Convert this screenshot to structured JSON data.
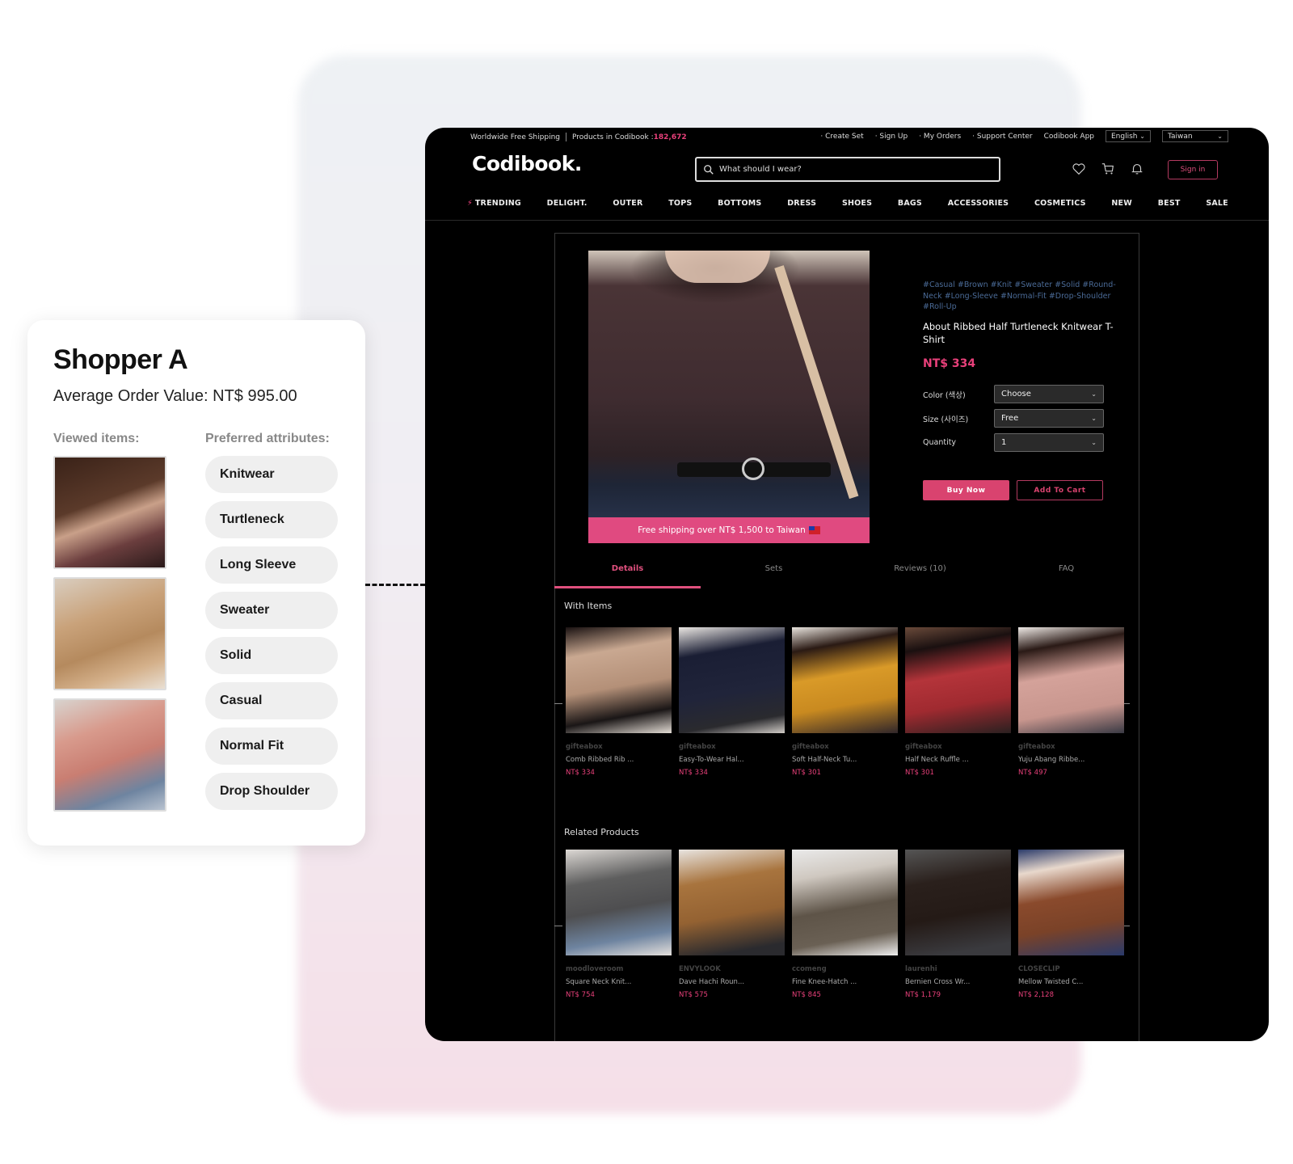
{
  "shopper": {
    "title": "Shopper A",
    "aov": "Average Order Value: NT$ 995.00",
    "viewed_label": "Viewed items:",
    "attrs_label": "Preferred attributes:",
    "viewed": [
      "brown-knit-sweater-image",
      "beige-knit-sweater-image",
      "pink-knit-sweater-image"
    ],
    "attributes": [
      "Knitwear",
      "Turtleneck",
      "Long Sleeve",
      "Sweater",
      "Solid",
      "Casual",
      "Normal Fit",
      "Drop Shoulder"
    ]
  },
  "store": {
    "topbar": {
      "shipping": "Worldwide Free Shipping",
      "products_label": "Products in Codibook : ",
      "products_count": "182,672",
      "links": [
        "· Create Set",
        "· Sign Up",
        "· My Orders",
        "· Support Center",
        "Codibook App"
      ],
      "language": "English",
      "country": "Taiwan"
    },
    "logo": "Codibook.",
    "search_placeholder": "What should I wear?",
    "signin": "Sign in",
    "nav": [
      "TRENDING",
      "DELIGHT.",
      "OUTER",
      "TOPS",
      "BOTTOMS",
      "DRESS",
      "SHOES",
      "BAGS",
      "ACCESSORIES",
      "COSMETICS",
      "NEW",
      "BEST",
      "SALE"
    ],
    "product": {
      "banner": "Free shipping over NT$ 1,500 to Taiwan",
      "tags": "#Casual #Brown #Knit #Sweater #Solid #Round-Neck #Long-Sleeve #Normal-Fit #Drop-Shoulder #Roll-Up",
      "title": "About Ribbed Half Turtleneck Knitwear T-Shirt",
      "price": "NT$ 334",
      "options": [
        {
          "label": "Color (색상)",
          "value": "Choose"
        },
        {
          "label": "Size (사이즈)",
          "value": "Free"
        },
        {
          "label": "Quantity",
          "value": "1"
        }
      ],
      "buy_now": "Buy Now",
      "add_to_cart": "Add To Cart"
    },
    "tabs": [
      "Details",
      "Sets",
      "Reviews (10)",
      "FAQ"
    ],
    "active_tab": "Details",
    "with_items": {
      "title": "With Items",
      "items": [
        {
          "brand": "gifteabox",
          "name": "Comb Ribbed Rib ...",
          "price": "NT$ 334"
        },
        {
          "brand": "gifteabox",
          "name": "Easy-To-Wear Hal...",
          "price": "NT$ 334"
        },
        {
          "brand": "gifteabox",
          "name": "Soft Half-Neck Tu...",
          "price": "NT$ 301"
        },
        {
          "brand": "gifteabox",
          "name": "Half Neck Ruffle ...",
          "price": "NT$ 301"
        },
        {
          "brand": "gifteabox",
          "name": "Yuju Abang Ribbe...",
          "price": "NT$ 497"
        }
      ]
    },
    "related": {
      "title": "Related Products",
      "items": [
        {
          "brand": "moodloveroom",
          "name": "Square Neck Knit...",
          "price": "NT$ 754"
        },
        {
          "brand": "ENVYLOOK",
          "name": "Dave Hachi Roun...",
          "price": "NT$ 575"
        },
        {
          "brand": "ccomeng",
          "name": "Fine Knee-Hatch ...",
          "price": "NT$ 845"
        },
        {
          "brand": "laurenhi",
          "name": "Bernien Cross Wr...",
          "price": "NT$ 1,179"
        },
        {
          "brand": "CLOSECLIP",
          "name": "Mellow Twisted C...",
          "price": "NT$ 2,128"
        }
      ]
    },
    "colors": {
      "accent": "#e0507e",
      "tag": "#4a6a96",
      "background": "#000000"
    }
  }
}
